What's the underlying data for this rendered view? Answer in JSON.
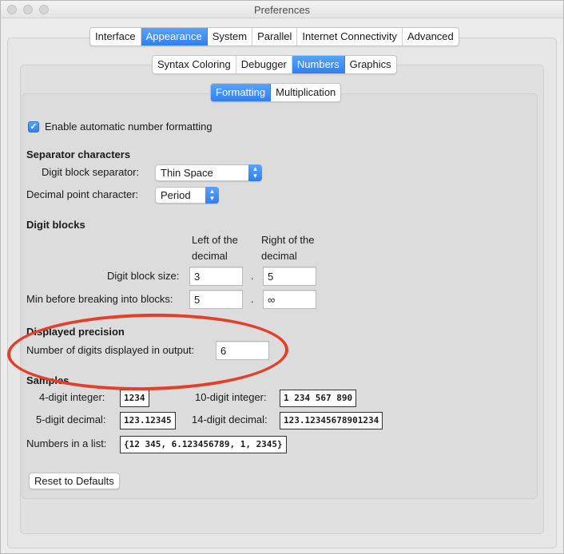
{
  "window": {
    "title": "Preferences"
  },
  "main_tabs": [
    {
      "label": "Interface",
      "active": false
    },
    {
      "label": "Appearance",
      "active": true
    },
    {
      "label": "System",
      "active": false
    },
    {
      "label": "Parallel",
      "active": false
    },
    {
      "label": "Internet Connectivity",
      "active": false
    },
    {
      "label": "Advanced",
      "active": false
    }
  ],
  "sub_tabs": [
    {
      "label": "Syntax Coloring",
      "active": false
    },
    {
      "label": "Debugger",
      "active": false
    },
    {
      "label": "Numbers",
      "active": true
    },
    {
      "label": "Graphics",
      "active": false
    }
  ],
  "inner_tabs": [
    {
      "label": "Formatting",
      "active": true
    },
    {
      "label": "Multiplication",
      "active": false
    }
  ],
  "formatting": {
    "enable_checkbox": {
      "label": "Enable automatic number formatting",
      "checked": true
    },
    "separator": {
      "heading": "Separator characters",
      "digit_block_label": "Digit block separator:",
      "digit_block_value": "Thin Space",
      "decimal_point_label": "Decimal point character:",
      "decimal_point_value": "Period"
    },
    "digit_blocks": {
      "heading": "Digit blocks",
      "left_header_1": "Left of the",
      "left_header_2": "decimal",
      "right_header_1": "Right of the",
      "right_header_2": "decimal",
      "block_size_label": "Digit block size:",
      "block_size_left": "3",
      "block_size_right": "5",
      "min_label": "Min before breaking into blocks:",
      "min_left": "5",
      "min_right": "∞",
      "dot": "."
    },
    "precision": {
      "heading": "Displayed precision",
      "label": "Number of digits displayed in output:",
      "value": "6"
    },
    "samples": {
      "heading": "Samples",
      "four_digit_label": "4-digit integer:",
      "four_digit_value": "1234",
      "ten_digit_label": "10-digit integer:",
      "ten_digit_value": "1 234 567 890",
      "five_decimal_label": "5-digit decimal:",
      "five_decimal_value": "123.12345",
      "fourteen_decimal_label": "14-digit decimal:",
      "fourteen_decimal_value": "123.12345678901234",
      "list_label": "Numbers in a list:",
      "list_value": "{12 345, 6.123456789, 1, 2345}"
    },
    "reset_button": "Reset to Defaults"
  },
  "annotation": {
    "color": "#e2402a"
  }
}
